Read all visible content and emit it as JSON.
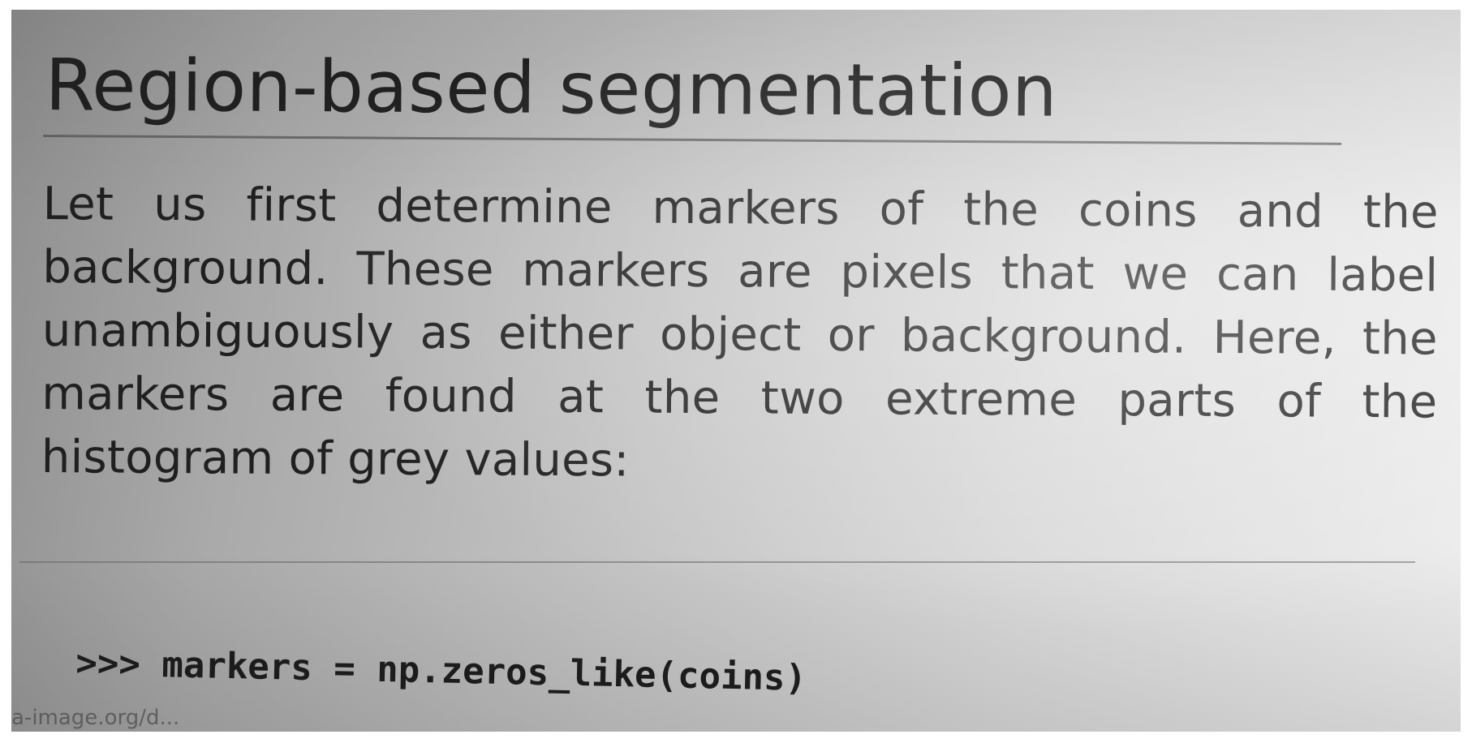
{
  "document": {
    "heading": "Region-based segmentation",
    "paragraph": "Let us first determine markers of the coins and the background. These markers are pixels that we can label unambiguously as either object or background. Here, the markers are found at the two extreme parts of the histogram of grey values:",
    "code_prompt": ">>>",
    "code": "markers = np.zeros_like(coins)",
    "watermark": "a-image.org/d..."
  }
}
